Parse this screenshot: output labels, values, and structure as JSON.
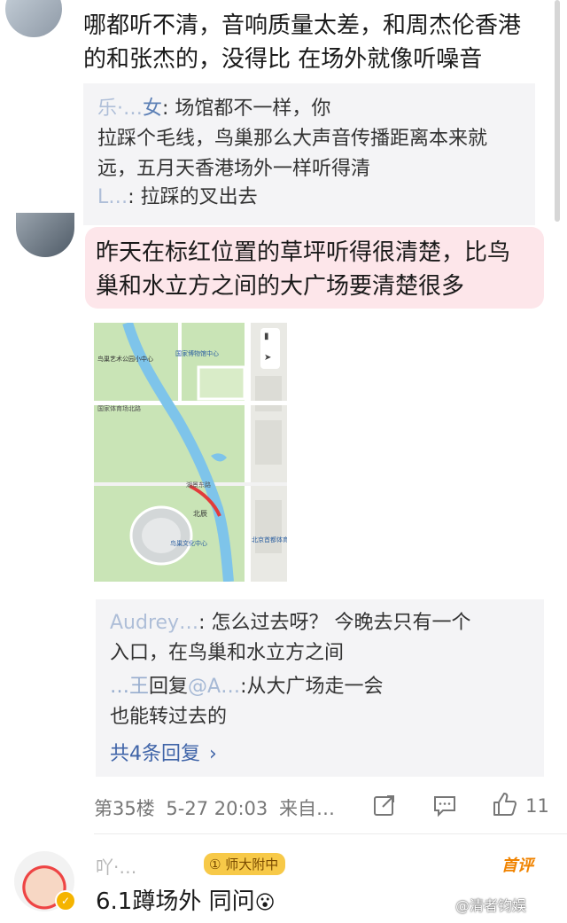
{
  "comment1": {
    "text_line1": "哪都听不清，音响质量太差，和周杰伦香港",
    "text_line2": "的和张杰的，没得比 在场外就像听噪音",
    "replies": [
      {
        "name": "乐·…",
        "suffix": "女",
        "text_line1": ": 场馆都不一样，你",
        "text_line2": "拉踩个毛线，鸟巢那么大声音传播距离本来就",
        "text_line3": "远，五月天香港场外一样听得清"
      },
      {
        "name": "L…",
        "text": ": 拉踩的叉出去"
      }
    ]
  },
  "comment2": {
    "text_line1": "昨天在标红位置的草坪听得很清楚，比鸟",
    "text_line2": "巢和水立方之间的大广场要清楚很多",
    "map": {
      "poi1": "鸟巢艺术公园小中心",
      "poi2": "国家体育场北路",
      "poi3": "北辰",
      "poi4": "鸟巢文化中心",
      "poi5": "北京首都体育馆",
      "road_label": "湖景东路",
      "museum": "国家博物馆中心"
    },
    "replies": [
      {
        "name": "Audrey…",
        "text": ": 怎么过去呀？ 今晚去只有一个",
        "text_line2": "入口，在鸟巢和水立方之间"
      },
      {
        "name": "…王",
        "reply_word": "回复",
        "at_name": "@A…",
        "text": ":从大广场走一会",
        "text_line2": "也能转过去的"
      }
    ],
    "more_replies": "共4条回复",
    "floor": "第35楼",
    "datetime": "5-27 20:03",
    "source": "来自…",
    "like_count": "11"
  },
  "comment3": {
    "username": "吖·…",
    "badge": "师大附中",
    "tag": "首评",
    "text": "6.1蹲场外 同问",
    "emoji": "😮"
  },
  "watermark": "@清者钧娱",
  "colors": {
    "accent_blue": "#3f64a8",
    "pink_highlight": "#fde6ea",
    "badge_yellow": "#f7c948",
    "tag_orange": "#f08300"
  }
}
